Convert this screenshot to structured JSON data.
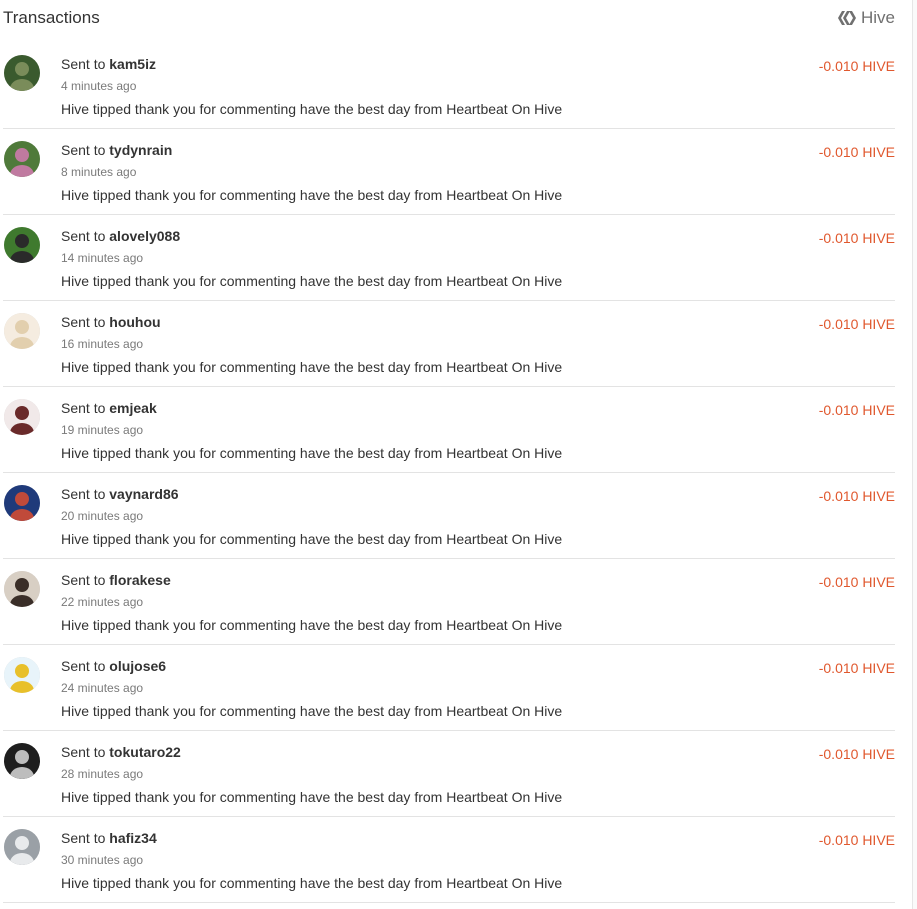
{
  "header": {
    "title": "Transactions",
    "brand_label": "Hive",
    "brand_icon": "hive-logo-icon"
  },
  "colors": {
    "amount": "#e0582e",
    "text": "#333333",
    "muted": "#7a7a7a",
    "divider": "#e3e3e3"
  },
  "transactions": [
    {
      "prefix": "Sent to",
      "user": "kam5iz",
      "time": "4 minutes ago",
      "memo": "Hive tipped thank you for commenting have the best day from Heartbeat On Hive",
      "amount": "-0.010 HIVE",
      "avatar_colors": [
        "#3a5a2e",
        "#7a8c5a"
      ]
    },
    {
      "prefix": "Sent to",
      "user": "tydynrain",
      "time": "8 minutes ago",
      "memo": "Hive tipped thank you for commenting have the best day from Heartbeat On Hive",
      "amount": "-0.010 HIVE",
      "avatar_colors": [
        "#4f7a3a",
        "#c07aa0"
      ]
    },
    {
      "prefix": "Sent to",
      "user": "alovely088",
      "time": "14 minutes ago",
      "memo": "Hive tipped thank you for commenting have the best day from Heartbeat On Hive",
      "amount": "-0.010 HIVE",
      "avatar_colors": [
        "#3f7a2e",
        "#2a2a2a"
      ]
    },
    {
      "prefix": "Sent to",
      "user": "houhou",
      "time": "16 minutes ago",
      "memo": "Hive tipped thank you for commenting have the best day from Heartbeat On Hive",
      "amount": "-0.010 HIVE",
      "avatar_colors": [
        "#f5ece0",
        "#e2cfae"
      ]
    },
    {
      "prefix": "Sent to",
      "user": "emjeak",
      "time": "19 minutes ago",
      "memo": "Hive tipped thank you for commenting have the best day from Heartbeat On Hive",
      "amount": "-0.010 HIVE",
      "avatar_colors": [
        "#f1e9e9",
        "#6a2a2a"
      ]
    },
    {
      "prefix": "Sent to",
      "user": "vaynard86",
      "time": "20 minutes ago",
      "memo": "Hive tipped thank you for commenting have the best day from Heartbeat On Hive",
      "amount": "-0.010 HIVE",
      "avatar_colors": [
        "#1f3a7a",
        "#c04a3a"
      ]
    },
    {
      "prefix": "Sent to",
      "user": "florakese",
      "time": "22 minutes ago",
      "memo": "Hive tipped thank you for commenting have the best day from Heartbeat On Hive",
      "amount": "-0.010 HIVE",
      "avatar_colors": [
        "#d8cfc4",
        "#3a2e28"
      ]
    },
    {
      "prefix": "Sent to",
      "user": "olujose6",
      "time": "24 minutes ago",
      "memo": "Hive tipped thank you for commenting have the best day from Heartbeat On Hive",
      "amount": "-0.010 HIVE",
      "avatar_colors": [
        "#e8f4fa",
        "#e8c02a"
      ]
    },
    {
      "prefix": "Sent to",
      "user": "tokutaro22",
      "time": "28 minutes ago",
      "memo": "Hive tipped thank you for commenting have the best day from Heartbeat On Hive",
      "amount": "-0.010 HIVE",
      "avatar_colors": [
        "#1e1e1e",
        "#bdbdbd"
      ]
    },
    {
      "prefix": "Sent to",
      "user": "hafiz34",
      "time": "30 minutes ago",
      "memo": "Hive tipped thank you for commenting have the best day from Heartbeat On Hive",
      "amount": "-0.010 HIVE",
      "avatar_colors": [
        "#9aa0a6",
        "#e8eaec"
      ]
    }
  ]
}
